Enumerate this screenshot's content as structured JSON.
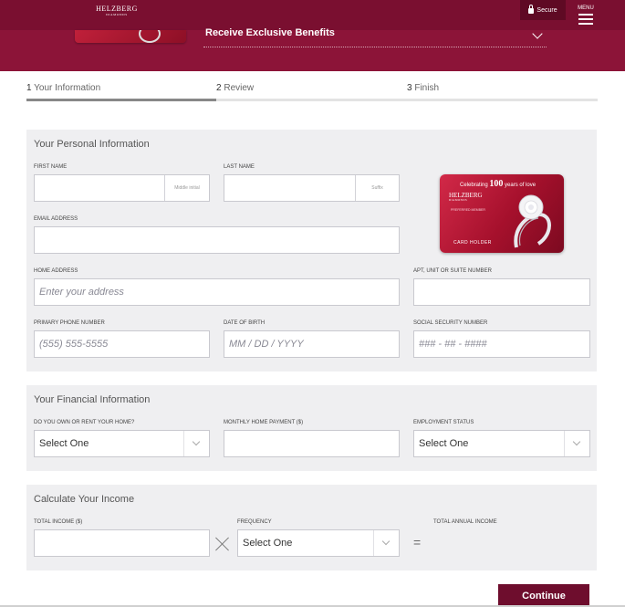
{
  "header": {
    "logo_main": "HELZBERG",
    "logo_sub": "DIAMONDS",
    "secure_label": "Secure",
    "menu_label": "MENU",
    "banner_title": "Receive Exclusive Benefits"
  },
  "steps": [
    {
      "number": "1",
      "label": "Your Information"
    },
    {
      "number": "2",
      "label": "Review"
    },
    {
      "number": "3",
      "label": "Finish"
    }
  ],
  "personal": {
    "title": "Your Personal Information",
    "first_name_label": "FIRST NAME",
    "middle_initial": "Middle initial",
    "last_name_label": "LAST NAME",
    "suffix": "Suffix",
    "email_label": "EMAIL ADDRESS",
    "home_address_label": "HOME ADDRESS",
    "home_address_placeholder": "Enter your address",
    "apt_label": "APT, UNIT OR SUITE NUMBER",
    "phone_label": "PRIMARY PHONE NUMBER",
    "phone_placeholder": "(555) 555-5555",
    "dob_label": "DATE OF BIRTH",
    "dob_placeholder": "MM / DD / YYYY",
    "ssn_label": "SOCIAL SECURITY NUMBER",
    "ssn_placeholder": "### - ## - ####"
  },
  "card": {
    "tagline_pre": "Celebrating",
    "tagline_num": "100",
    "tagline_post": "years of love",
    "brand": "HELZBERG",
    "brand_sub": "DIAMONDS",
    "preferred": "PREFERRED MEMBER",
    "holder": "CARD HOLDER"
  },
  "financial": {
    "title": "Your Financial Information",
    "own_rent_label": "DO YOU OWN OR RENT YOUR HOME?",
    "own_rent_value": "Select One",
    "monthly_payment_label": "MONTHLY HOME PAYMENT ($)",
    "employment_label": "EMPLOYMENT STATUS",
    "employment_value": "Select One"
  },
  "income": {
    "title": "Calculate Your Income",
    "total_income_label": "TOTAL INCOME ($)",
    "frequency_label": "FREQUENCY",
    "frequency_value": "Select One",
    "annual_label": "TOTAL ANNUAL INCOME",
    "equals": "="
  },
  "actions": {
    "continue_label": "Continue"
  }
}
